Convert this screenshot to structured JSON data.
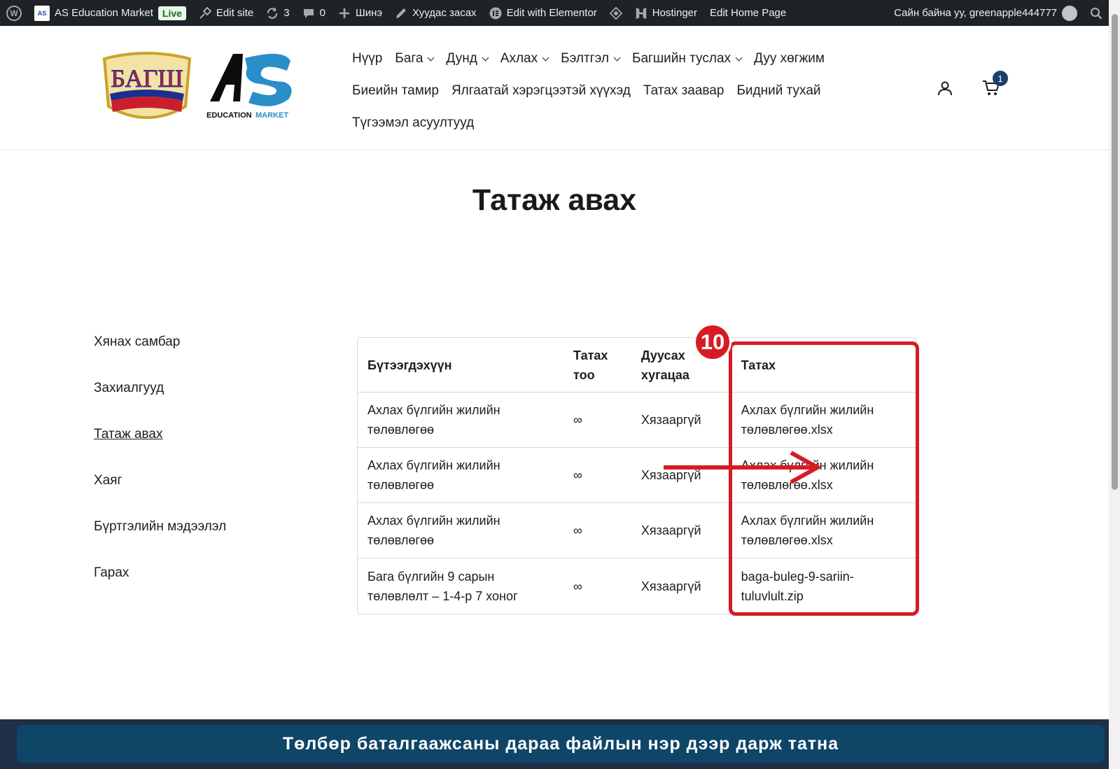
{
  "adminbar": {
    "site_name": "AS Education Market",
    "live_label": "Live",
    "edit_site": "Edit site",
    "updates_count": "3",
    "comments_count": "0",
    "new_label": "Шинэ",
    "edit_page": "Хуудас засах",
    "elementor": "Edit with Elementor",
    "hostinger": "Hostinger",
    "edit_home": "Edit Home Page",
    "greeting": "Сайн байна уу, greenapple444777"
  },
  "logo": {
    "bagsh_text": "БАГШ",
    "as_text": "AS",
    "as_sub_a": "EDUCATION",
    "as_sub_b": "MARKET"
  },
  "nav": {
    "row1": [
      {
        "label": "Нүүр",
        "dropdown": false
      },
      {
        "label": "Бага",
        "dropdown": true
      },
      {
        "label": "Дунд",
        "dropdown": true
      },
      {
        "label": "Ахлах",
        "dropdown": true
      },
      {
        "label": "Бэлтгэл",
        "dropdown": true
      },
      {
        "label": "Багшийн туслах",
        "dropdown": true
      },
      {
        "label": "Дуу хөгжим",
        "dropdown": false
      }
    ],
    "row2": [
      "Биеийн тамир",
      "Ялгаатай хэрэгцээтэй хүүхэд",
      "Татах заавар",
      "Бидний тухай"
    ],
    "row3": [
      "Түгээмэл асуултууд"
    ]
  },
  "cart": {
    "count": "1"
  },
  "page": {
    "title": "Татаж авах"
  },
  "account_nav": [
    {
      "label": "Хянах самбар",
      "active": false
    },
    {
      "label": "Захиалгууд",
      "active": false
    },
    {
      "label": "Татаж авах",
      "active": true
    },
    {
      "label": "Хаяг",
      "active": false
    },
    {
      "label": "Бүртгэлийн мэдээлэл",
      "active": false
    },
    {
      "label": "Гарах",
      "active": false
    }
  ],
  "table": {
    "headers": {
      "product": "Бүтээгдэхүүн",
      "remaining_a": "Татах",
      "remaining_b": "тоо",
      "expires_a": "Дуусах",
      "expires_b": "хугацаа",
      "download": "Татах"
    },
    "rows": [
      {
        "product_a": "Ахлах бүлгийн жилийн",
        "product_b": "төлөвлөгөө",
        "remaining": "∞",
        "expires": "Хязааргүй",
        "file_a": "Ахлах бүлгийн жилийн",
        "file_b": "төлөвлөгөө.xlsx"
      },
      {
        "product_a": "Ахлах бүлгийн жилийн",
        "product_b": "төлөвлөгөө",
        "remaining": "∞",
        "expires": "Хязааргүй",
        "file_a": "Ахлах бүлгийн жилийн",
        "file_b": "төлөвлөгөө.xlsx"
      },
      {
        "product_a": "Ахлах бүлгийн жилийн",
        "product_b": "төлөвлөгөө",
        "remaining": "∞",
        "expires": "Хязааргүй",
        "file_a": "Ахлах бүлгийн жилийн",
        "file_b": "төлөвлөгөө.xlsx"
      },
      {
        "product_a": "Бага бүлгийн 9 сарын",
        "product_b": "төлөвлөлт – 1-4-р 7 хоног",
        "remaining": "∞",
        "expires": "Хязааргүй",
        "file_a": "baga-buleg-9-sariin-",
        "file_b": "tuluvlult.zip"
      }
    ]
  },
  "annotation": {
    "step": "10",
    "color": "#d81b23"
  },
  "caption": "Төлбөр баталгаажсаны дараа файлын нэр дээр дарж татна"
}
